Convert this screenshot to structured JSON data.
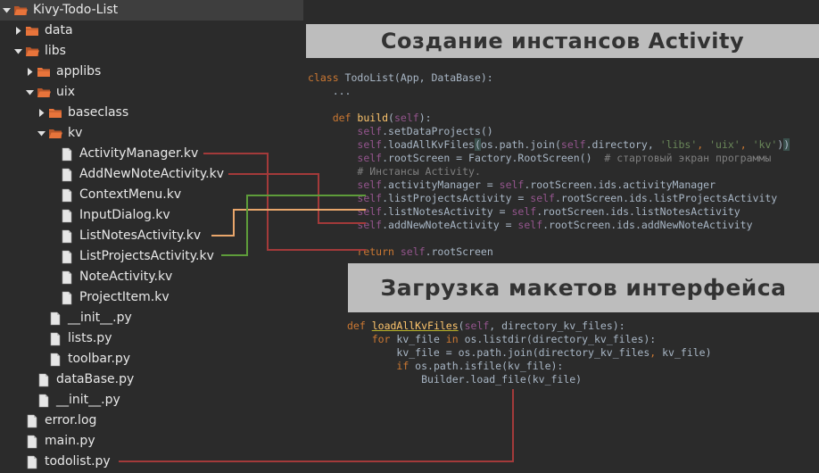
{
  "tree": [
    {
      "label": "Kivy-Todo-List",
      "type": "folder",
      "expanded": true,
      "depth": 0,
      "selected": true
    },
    {
      "label": "data",
      "type": "folder",
      "expanded": false,
      "depth": 1
    },
    {
      "label": "libs",
      "type": "folder",
      "expanded": true,
      "depth": 1
    },
    {
      "label": "applibs",
      "type": "folder",
      "expanded": false,
      "depth": 2
    },
    {
      "label": "uix",
      "type": "folder",
      "expanded": true,
      "depth": 2
    },
    {
      "label": "baseclass",
      "type": "folder",
      "expanded": false,
      "depth": 3
    },
    {
      "label": "kv",
      "type": "folder",
      "expanded": true,
      "depth": 3
    },
    {
      "label": "ActivityManager.kv",
      "type": "file",
      "depth": 4
    },
    {
      "label": "AddNewNoteActivity.kv",
      "type": "file",
      "depth": 4
    },
    {
      "label": "ContextMenu.kv",
      "type": "file",
      "depth": 4
    },
    {
      "label": "InputDialog.kv",
      "type": "file",
      "depth": 4
    },
    {
      "label": "ListNotesActivity.kv",
      "type": "file",
      "depth": 4
    },
    {
      "label": "ListProjectsActivity.kv",
      "type": "file",
      "depth": 4
    },
    {
      "label": "NoteActivity.kv",
      "type": "file",
      "depth": 4
    },
    {
      "label": "ProjectItem.kv",
      "type": "file",
      "depth": 4
    },
    {
      "label": "__init__.py",
      "type": "file",
      "depth": 3
    },
    {
      "label": "lists.py",
      "type": "file",
      "depth": 3
    },
    {
      "label": "toolbar.py",
      "type": "file",
      "depth": 3
    },
    {
      "label": "dataBase.py",
      "type": "file",
      "depth": 2
    },
    {
      "label": "__init__.py",
      "type": "file",
      "depth": 2
    },
    {
      "label": "error.log",
      "type": "file",
      "depth": 1
    },
    {
      "label": "main.py",
      "type": "file",
      "depth": 1
    },
    {
      "label": "todolist.py",
      "type": "file",
      "depth": 1
    }
  ],
  "banners": {
    "activity": "Создание инстансов Activity",
    "layouts": "Загрузка макетов интерфейса"
  },
  "code1": {
    "class_kw": "class",
    "class_decl": " TodoList(App, DataBase):",
    "ellipsis": "...",
    "def_kw": "def",
    "build_name": "build",
    "self": "self",
    "build_sig_open": "(",
    "build_sig_close": "):",
    "l_set_data": ".setDataProjects()",
    "l_load_a": ".loadAllKvFiles",
    "l_load_b": "os.path.join(",
    "l_load_c": ".directory, ",
    "str_libs": "'libs'",
    "comma": ", ",
    "str_uix": "'uix'",
    "str_kv": "'kv'",
    "paren_open": "(",
    "paren_close": ")",
    "l_root": ".rootScreen = Factory.RootScreen()  ",
    "cm_root": "# стартовый экран программы",
    "cm_inst": "# Инстансы Activity.",
    "l_am": ".activityManager = ",
    "l_am_r": ".rootScreen.ids.activityManager",
    "l_lp": ".listProjectsActivity = ",
    "l_lp_r": ".rootScreen.ids.listProjectsActivity",
    "l_ln": ".listNotesActivity = ",
    "l_ln_r": ".rootScreen.ids.listNotesActivity",
    "l_an": ".addNewNoteActivity = ",
    "l_an_r": ".rootScreen.ids.addNewNoteActivity",
    "return_kw": "return",
    "return_r": ".rootScreen"
  },
  "code2": {
    "def_kw": "def",
    "fn_name": "loadAllKvFiles",
    "open": "(",
    "self": "self",
    "sig_rest": ", directory_kv_files):",
    "for_kw": "for",
    "for_a": " kv_file ",
    "in_kw": "in",
    "for_b": " os.listdir(directory_kv_files):",
    "join_a": "kv_file = os.path.join(directory_kv_files",
    "comma": ", ",
    "join_b": "kv_file)",
    "if_kw": "if",
    "if_r": " os.path.isfile(kv_file):",
    "builder": "Builder.load_file(kv_file)"
  },
  "colors": {
    "background": "#2b2b2b",
    "folder": "#e8743b",
    "file": "#e6e6e6",
    "keyword": "#cc7832",
    "self": "#94558d",
    "string": "#6a8759",
    "comment": "#808080",
    "function": "#ffc66d",
    "line_red": "#a33a3a",
    "line_green": "#5e9c3a",
    "line_orange": "#e9a66b"
  }
}
